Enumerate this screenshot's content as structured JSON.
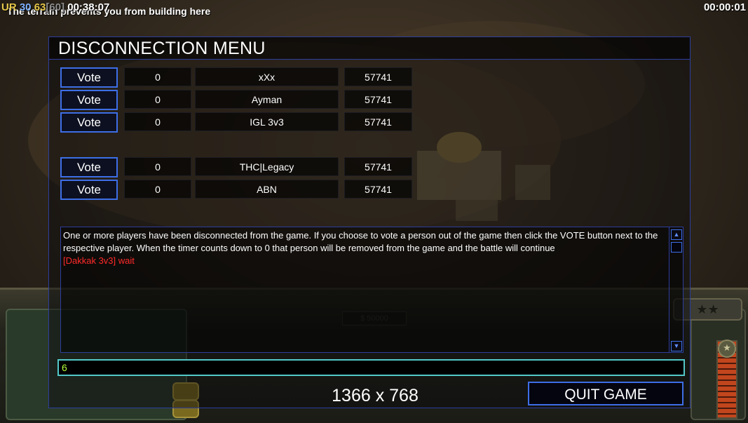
{
  "overlay": {
    "stat_ur": "UR",
    "stat_a": "30",
    "stat_b": "63",
    "stat_c": "[60]",
    "elapsed": "00:38:07",
    "message": "The terrain prevents you from building here",
    "timer": "00:00:01"
  },
  "hud": {
    "money": "$ 50000",
    "stars": "★★"
  },
  "dialog": {
    "title": "DISCONNECTION MENU",
    "vote_label": "Vote",
    "players": [
      {
        "votes": "0",
        "name": "xXx",
        "ping": "57741"
      },
      {
        "votes": "0",
        "name": "Ayman",
        "ping": "57741"
      },
      {
        "votes": "0",
        "name": "IGL 3v3",
        "ping": "57741"
      },
      {
        "votes": "0",
        "name": "THC|Legacy",
        "ping": "57741"
      },
      {
        "votes": "0",
        "name": "ABN",
        "ping": "57741"
      }
    ],
    "chat_info": "One or more players have been disconnected from the game. If you choose to vote a person out of the game then click the VOTE button next to the respective player. When the timer counts down to 0 that person will be removed from the game and the battle will continue",
    "chat_message": "[Dakkak 3v3] wait",
    "input_value": "6",
    "resolution": "1366 x 768",
    "quit_label": "QUIT GAME"
  },
  "colors": {
    "border_blue": "#3d6ee6",
    "chat_red": "#ff2a2a",
    "input_text": "#b4ff3a",
    "input_border": "#54c8c8"
  }
}
